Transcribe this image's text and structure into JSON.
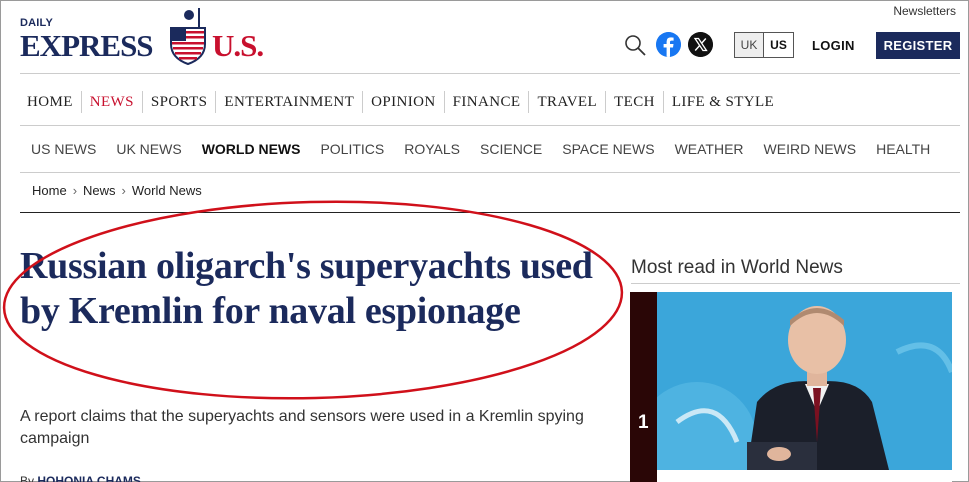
{
  "header": {
    "newsletters_label": "Newsletters",
    "logo": {
      "daily": "DAILY",
      "express": "EXPRESS",
      "us": "U.S."
    },
    "edition": {
      "uk": "UK",
      "us": "US",
      "selected": "US"
    },
    "login_label": "LOGIN",
    "register_label": "REGISTER",
    "icons": {
      "search": "search-icon",
      "facebook": "facebook-icon",
      "x": "x-icon"
    }
  },
  "nav_primary": [
    {
      "label": "HOME"
    },
    {
      "label": "NEWS",
      "active": true
    },
    {
      "label": "SPORTS"
    },
    {
      "label": "ENTERTAINMENT"
    },
    {
      "label": "OPINION"
    },
    {
      "label": "FINANCE"
    },
    {
      "label": "TRAVEL"
    },
    {
      "label": "TECH"
    },
    {
      "label": "LIFE & STYLE"
    }
  ],
  "nav_secondary": [
    {
      "label": "US NEWS"
    },
    {
      "label": "UK NEWS"
    },
    {
      "label": "WORLD NEWS",
      "active": true
    },
    {
      "label": "POLITICS"
    },
    {
      "label": "ROYALS"
    },
    {
      "label": "SCIENCE"
    },
    {
      "label": "SPACE NEWS"
    },
    {
      "label": "WEATHER"
    },
    {
      "label": "WEIRD NEWS"
    },
    {
      "label": "HEALTH"
    }
  ],
  "breadcrumb": [
    "Home",
    "News",
    "World News"
  ],
  "article": {
    "headline": "Russian oligarch's superyachts used by Kremlin for naval espionage",
    "subheadline": "A report claims that the superyachts and sensors were used in a Kremlin spying campaign",
    "byline_prefix": "By",
    "author": "HOHONIA CHAMS"
  },
  "sidebar": {
    "most_read_title": "Most read in World News",
    "top_item_number": "1"
  },
  "colors": {
    "brand_navy": "#1b2a5c",
    "brand_red": "#c8102e",
    "annotation_red": "#d0101a"
  }
}
